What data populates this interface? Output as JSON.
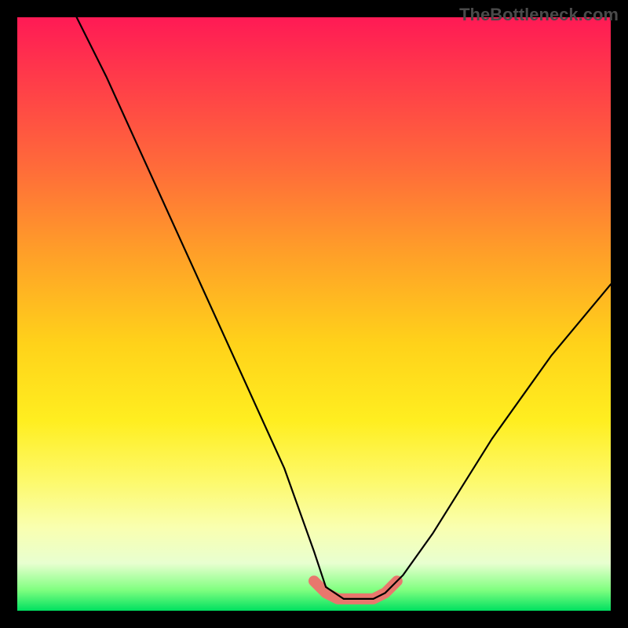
{
  "watermark": "TheBottleneck.com",
  "chart_data": {
    "type": "line",
    "title": "",
    "xlabel": "",
    "ylabel": "",
    "xlim": [
      0,
      100
    ],
    "ylim": [
      0,
      100
    ],
    "series": [
      {
        "name": "bottleneck-curve",
        "x": [
          10,
          15,
          20,
          25,
          30,
          35,
          40,
          45,
          50,
          52,
          55,
          58,
          60,
          62,
          65,
          70,
          75,
          80,
          85,
          90,
          95,
          100
        ],
        "values": [
          100,
          90,
          79,
          68,
          57,
          46,
          35,
          24,
          10,
          4,
          2,
          2,
          2,
          3,
          6,
          13,
          21,
          29,
          36,
          43,
          49,
          55
        ]
      },
      {
        "name": "optimal-band",
        "x": [
          50,
          52,
          54,
          56,
          58,
          60,
          62,
          64
        ],
        "values": [
          5,
          3,
          2,
          2,
          2,
          2,
          3,
          5
        ]
      }
    ],
    "colors": {
      "curve": "#000000",
      "optimal_band": "#e8776d",
      "gradient_top": "#ff1a55",
      "gradient_bottom": "#00e060"
    }
  }
}
